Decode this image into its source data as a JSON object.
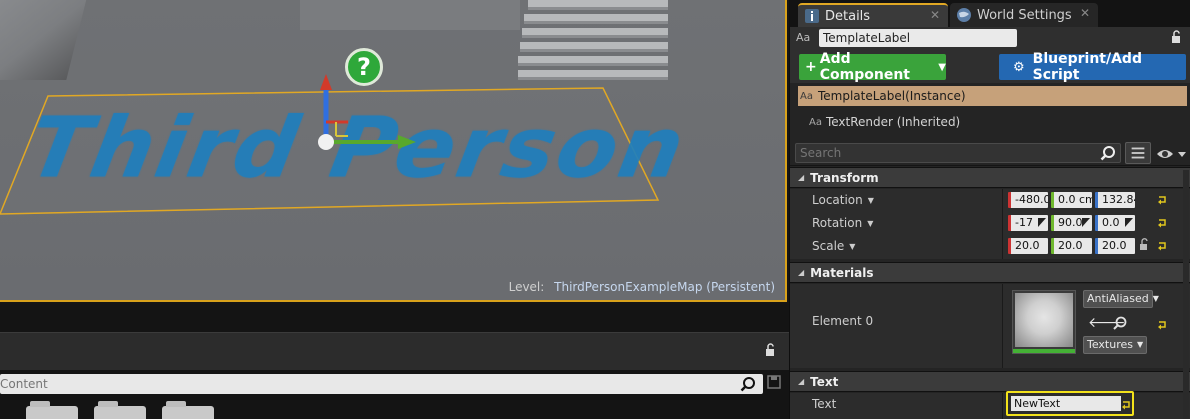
{
  "viewport": {
    "floor_text": "Third Person",
    "help_glyph": "?",
    "level_label": "Level:",
    "level_value": "ThirdPersonExampleMap (Persistent)"
  },
  "content_browser": {
    "search_placeholder": "Content"
  },
  "tabs": [
    {
      "label": "Details",
      "icon": "info-icon",
      "active": true
    },
    {
      "label": "World Settings",
      "icon": "globe-icon",
      "active": false
    }
  ],
  "details": {
    "name_icon_text": "Aa",
    "actor_name": "TemplateLabel",
    "add_component_label": "Add Component",
    "blueprint_label": "Blueprint/Add Script",
    "components": [
      {
        "icon_text": "Aa",
        "label": "TemplateLabel(Instance)",
        "selected": true
      },
      {
        "icon_text": "Aa",
        "label": "TextRender (Inherited)",
        "selected": false
      }
    ],
    "search_placeholder": "Search",
    "sections": {
      "transform": {
        "title": "Transform",
        "location": {
          "label": "Location",
          "x": "-480.0(",
          "y": "0.0 cm",
          "z": "132.84"
        },
        "rotation": {
          "label": "Rotation",
          "x": "-17",
          "y": "90.0",
          "z": "0.0"
        },
        "scale": {
          "label": "Scale",
          "x": "20.0",
          "y": "20.0",
          "z": "20.0"
        }
      },
      "materials": {
        "title": "Materials",
        "element_label": "Element 0",
        "material_combo": "AntiAliased",
        "textures_combo": "Textures"
      },
      "text": {
        "title": "Text",
        "text_label": "Text",
        "text_value": "NewText"
      }
    }
  },
  "colors": {
    "selection_orange": "#e1a824",
    "add_component_green": "#3aa33b",
    "blueprint_blue": "#2468b2",
    "selected_component_tan": "#c6a17a",
    "floor_text_blue": "#1f7fbd",
    "x_axis_red": "#cc3333",
    "y_axis_green": "#6fb82e",
    "z_axis_blue": "#3a73c9",
    "highlight_yellow": "#f3e21b"
  }
}
